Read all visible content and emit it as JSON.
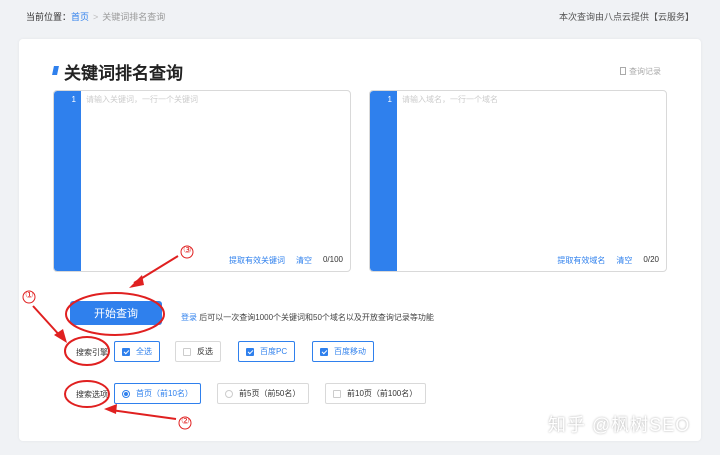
{
  "breadcrumb": {
    "prefix": "当前位置：",
    "home": "首页",
    "separator": ">",
    "current": "关键词排名查询"
  },
  "provider_text": "本次查询由八点云提供【云服务】",
  "page": {
    "title": "关键词排名查询",
    "history_label": "查询记录"
  },
  "keyword_box": {
    "line_number": "1",
    "placeholder": "请输入关键词，一行一个关键词",
    "extract_label": "提取有效关键词",
    "clear_label": "清空",
    "counter": "0/100"
  },
  "domain_box": {
    "line_number": "1",
    "placeholder": "请输入域名，一行一个域名",
    "extract_label": "提取有效域名",
    "clear_label": "清空",
    "counter": "0/20"
  },
  "start_button": "开始查询",
  "login_tip": {
    "link": "登录",
    "text": "后可以一次查询1000个关键词和50个域名以及开放查询记录等功能"
  },
  "engine_row": {
    "label": "搜索引擎",
    "options": [
      {
        "label": "全选",
        "checked": true
      },
      {
        "label": "反选",
        "checked": false
      },
      {
        "label": "百度PC",
        "checked": true
      },
      {
        "label": "百度移动",
        "checked": true
      }
    ]
  },
  "range_row": {
    "label": "搜索选项",
    "options": [
      {
        "label": "首页（前10名）",
        "selected": true
      },
      {
        "label": "前5页（前50名）",
        "selected": false
      },
      {
        "label": "前10页（前100名）",
        "selected": false
      }
    ]
  },
  "annotations": {
    "one": "①",
    "two": "②",
    "three": "③"
  },
  "watermark": "知乎 @枫树SEO",
  "colors": {
    "accent": "#2f80ed",
    "annotation": "#e02020",
    "background": "#f0f2f5"
  }
}
